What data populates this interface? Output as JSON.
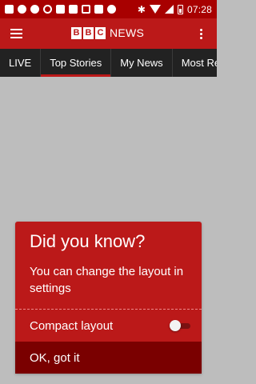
{
  "status_bar": {
    "time": "07:28",
    "left_icons": [
      "mail-icon",
      "chat-icon",
      "location-icon",
      "phone-icon",
      "cast-icon",
      "linkedin-icon",
      "square-icon",
      "bag-icon",
      "notification-icon"
    ],
    "right_icons": [
      "bluetooth-icon",
      "wifi-icon",
      "signal-icon",
      "battery-icon"
    ]
  },
  "app_bar": {
    "logo_letters": [
      "B",
      "B",
      "C"
    ],
    "logo_text": "NEWS",
    "brand_color": "#bb1919"
  },
  "tabs": [
    {
      "label": "LIVE",
      "active": false
    },
    {
      "label": "Top Stories",
      "active": true
    },
    {
      "label": "My News",
      "active": false
    },
    {
      "label": "Most Read",
      "active": false
    }
  ],
  "dialog": {
    "title": "Did you know?",
    "body": "You can change the layout in settings",
    "option_label": "Compact layout",
    "option_enabled": false,
    "confirm_label": "OK, got it"
  }
}
